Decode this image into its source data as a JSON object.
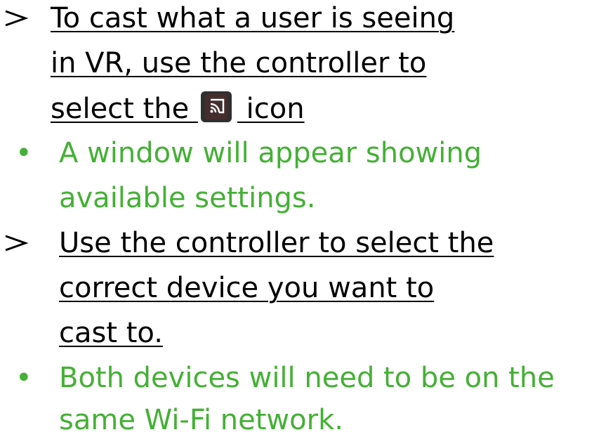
{
  "steps": [
    {
      "lines": [
        "To cast what a user is seeing ",
        "in VR, use the controller to ",
        "select the "
      ],
      "icon": "cast-icon",
      "after_icon": " icon"
    },
    {
      "lines": [
        "A window will appear showing",
        "available settings."
      ]
    },
    {
      "lines": [
        "Use the controller to select the",
        "correct device you want to ",
        "cast to."
      ]
    },
    {
      "lines": [
        "Both devices will need to be on the",
        "same Wi-Fi network."
      ]
    }
  ],
  "bullet_symbol": "•",
  "colors": {
    "text": "#000000",
    "note": "#44b035",
    "icon_bg": "#2f2f2f"
  }
}
